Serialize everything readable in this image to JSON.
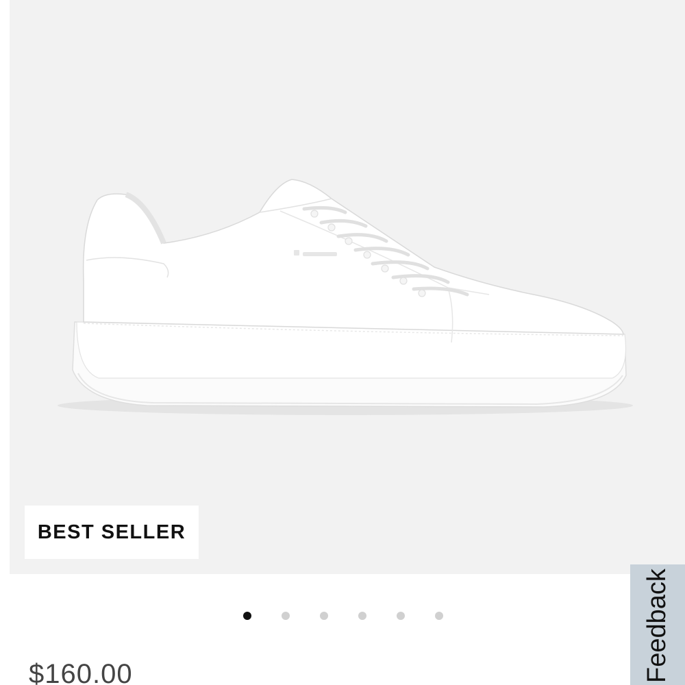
{
  "product": {
    "image_alt": "White leather low-top sneaker",
    "badge": "BEST SELLER",
    "price": "$160.00"
  },
  "carousel": {
    "dot_count": 6,
    "active_index": 0
  },
  "feedback": {
    "label": "Feedback"
  },
  "colors": {
    "image_bg": "#f2f2f2",
    "badge_bg": "#ffffff",
    "dot_active": "#111111",
    "dot_inactive": "#d0d0d0",
    "feedback_bg": "#c8d2da"
  }
}
